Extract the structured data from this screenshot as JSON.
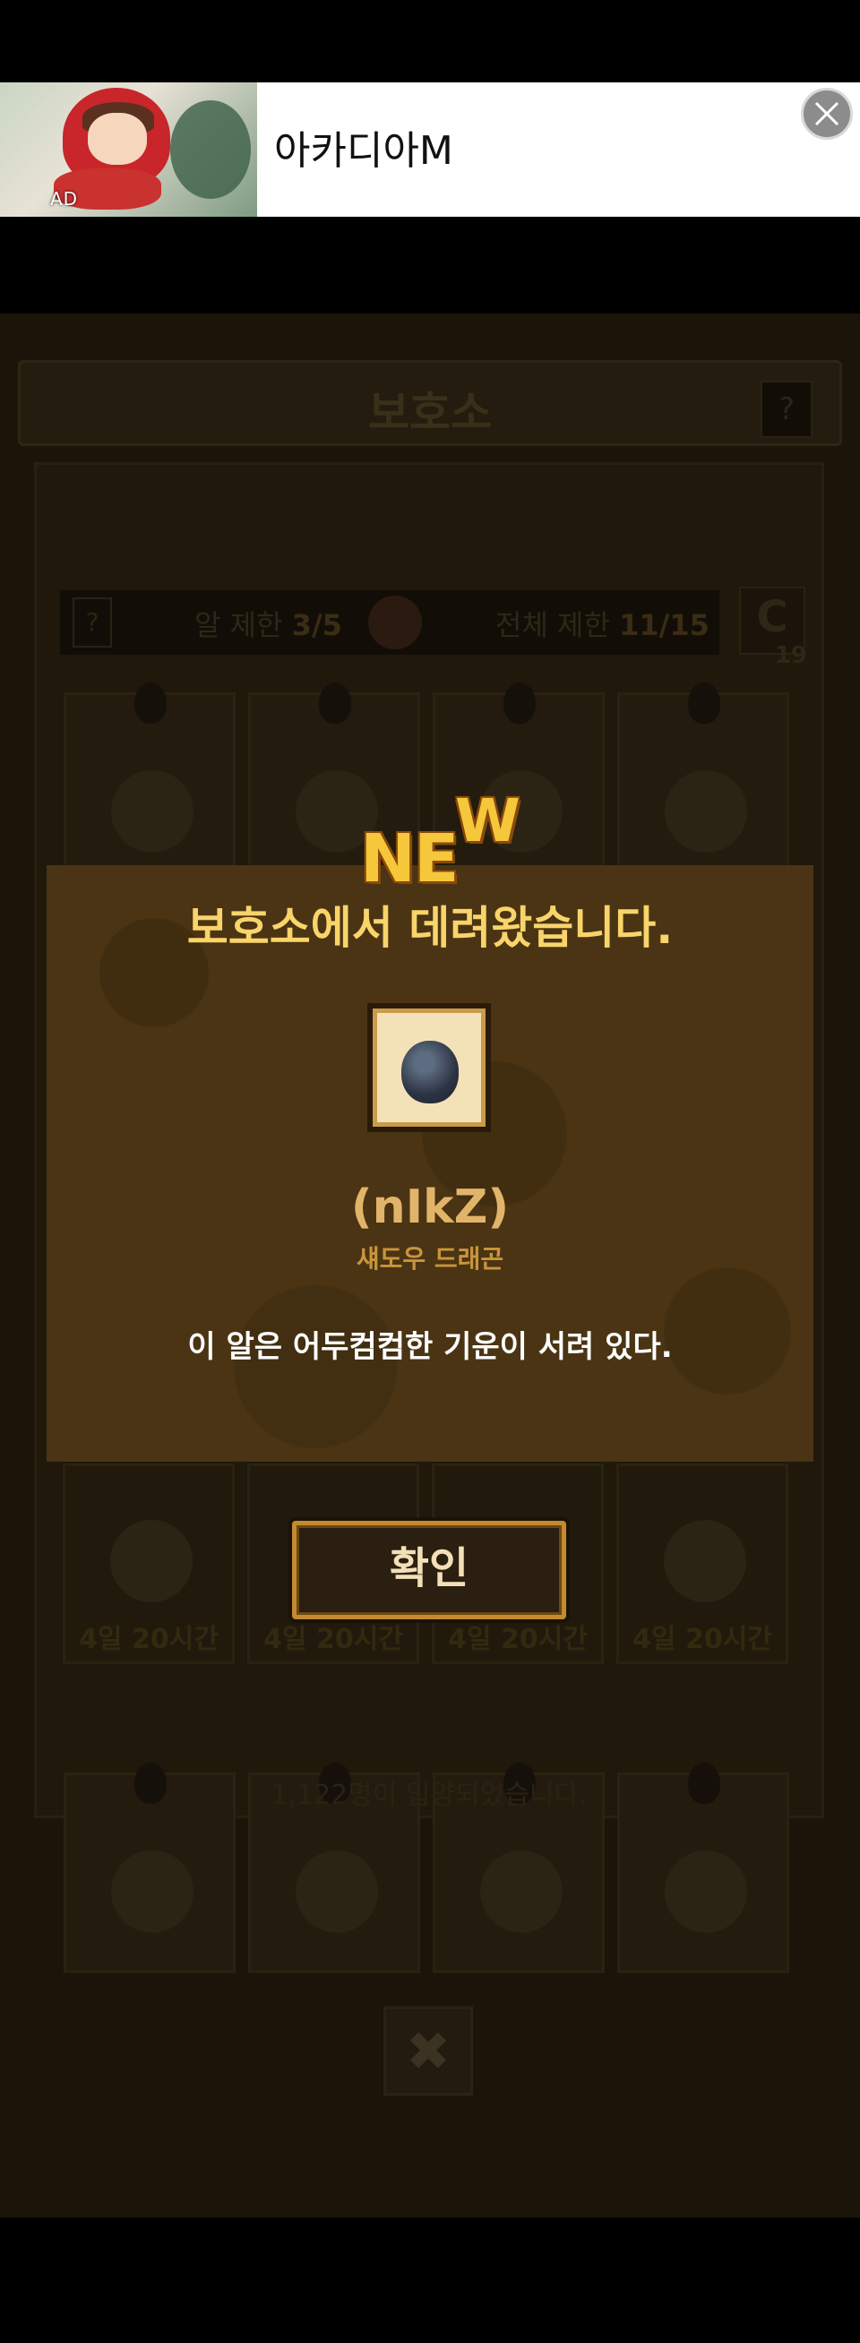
{
  "ad": {
    "label": "AD",
    "title": "아카디아M"
  },
  "game": {
    "title": "보호소",
    "help_label": "?",
    "description": "",
    "limits": {
      "help_label": "?",
      "egg_limit_label": "알 제한",
      "egg_limit_value": "3/5",
      "total_limit_label": "전체 제한",
      "total_limit_value": "11/15"
    },
    "refresh": {
      "icon_text": "C",
      "count": "19"
    },
    "cells": [
      {
        "time": ""
      },
      {
        "time": ""
      },
      {
        "time": ""
      },
      {
        "time": ""
      },
      {
        "time": "4일 20시간"
      },
      {
        "time": "4일 20시간"
      },
      {
        "time": "4일 20시간"
      },
      {
        "time": "4일 20시간"
      },
      {
        "time": ""
      },
      {
        "time": ""
      },
      {
        "time": ""
      },
      {
        "time": ""
      }
    ],
    "footer_text": "1,122명이 입양되었습니다.",
    "close_label": "✖"
  },
  "modal": {
    "badge_ne": "NE",
    "badge_w": "W",
    "title": "보호소에서 데려왔습니다.",
    "dragon_name": "(nIkZ)",
    "dragon_type": "섀도우 드래곤",
    "description": "이 알은 어두컴컴한 기운이 서려 있다.",
    "confirm_label": "확인"
  },
  "colors": {
    "modal_bg": "#4a3413",
    "title_gold": "#f8d46a",
    "accent_orange": "#c48a2f"
  }
}
